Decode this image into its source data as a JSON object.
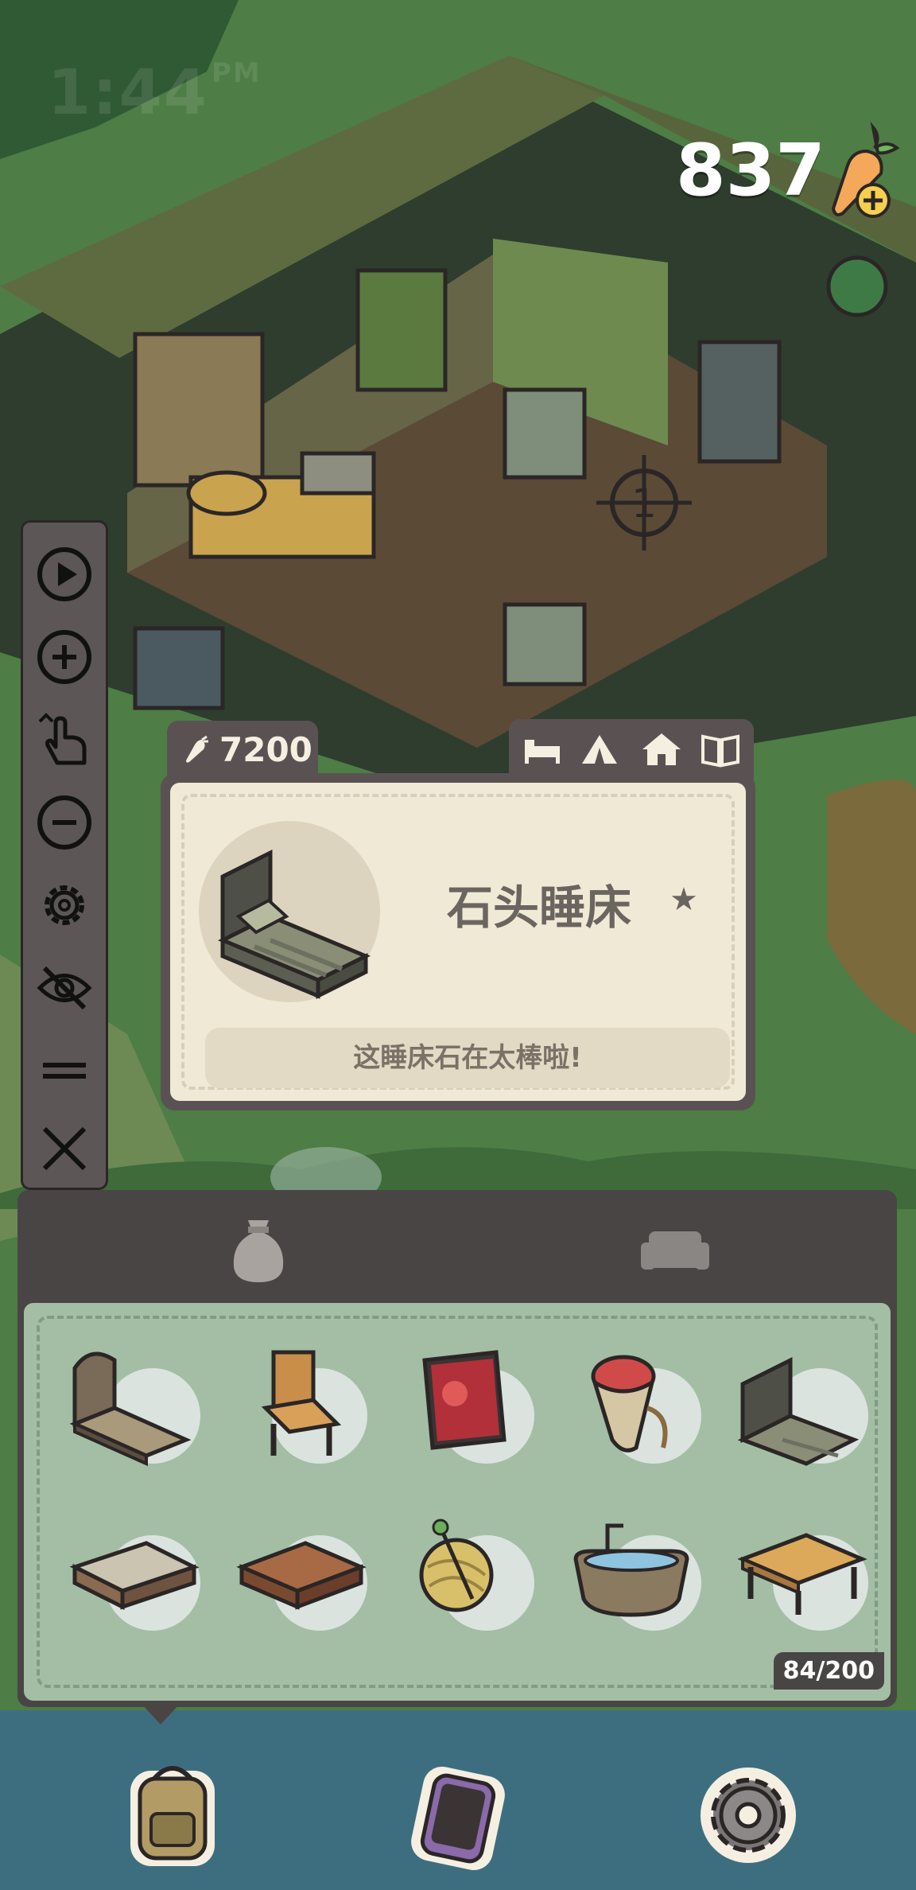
{
  "hud": {
    "clock": "1:44",
    "ampm": "PM",
    "carrot_count": "837"
  },
  "toolbar": {
    "items": [
      {
        "icon": "play-icon"
      },
      {
        "icon": "zoom-in-icon"
      },
      {
        "icon": "drag-hand-icon"
      },
      {
        "icon": "zoom-out-icon"
      },
      {
        "icon": "gear-icon"
      },
      {
        "icon": "hide-eye-icon"
      },
      {
        "icon": "equals-icon"
      },
      {
        "icon": "close-icon"
      }
    ]
  },
  "item_card": {
    "cost": "7200",
    "name": "石头睡床",
    "star": "★",
    "description": "这睡床石在太棒啦!",
    "category_tabs": [
      "bed-icon",
      "tent-icon",
      "house-icon",
      "book-icon"
    ]
  },
  "inventory": {
    "tabs": [
      "sack-icon",
      "sofa-icon"
    ],
    "count": "84/200",
    "items": [
      "wooden-arch-bed",
      "wooden-chair",
      "night-crawlers-book",
      "watermelon-hat",
      "stone-bed",
      "stone-bench",
      "wooden-tray-table",
      "yarn-ball",
      "bathtub",
      "wooden-table"
    ]
  },
  "bottom_nav": [
    "backpack-icon",
    "phone-icon",
    "settings-gear-icon"
  ],
  "colors": {
    "panel_dark": "#4a4545",
    "card_bg": "#f0e9d6",
    "grid_bg": "#a3bea5",
    "text_muted": "#6b6560"
  }
}
